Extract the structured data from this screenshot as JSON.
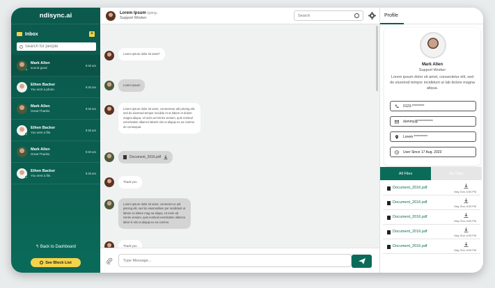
{
  "sidebar": {
    "brand": "ndisync.ai",
    "inbox_label": "Inbox",
    "add_label": "+",
    "search_placeholder": "Search for people",
    "contacts": [
      {
        "name": "Mark Allen",
        "preview": "sound good",
        "time": "9:40 am"
      },
      {
        "name": "Ethen Backer",
        "preview": "You sent a photo.",
        "time": "9:40 am"
      },
      {
        "name": "Mark Allen",
        "preview": "Great Thanks.",
        "time": "9:40 am"
      },
      {
        "name": "Ethen Backer",
        "preview": "You sent a file.",
        "time": "9:40 am"
      },
      {
        "name": "Mark Allen",
        "preview": "Great Thanks.",
        "time": "9:40 am"
      },
      {
        "name": "Ethen Backer",
        "preview": "You sent a file.",
        "time": "9:40 am"
      }
    ],
    "back_label": "Back to Dashboard",
    "block_label": "See Block List"
  },
  "chat": {
    "header_name": "Lorem Ipsum",
    "header_status": "typing..",
    "header_role": "Support Worker",
    "search_placeholder": "Search",
    "messages": [
      {
        "text": "Lorem ipsum dolor sit amet?"
      },
      {
        "text": "Lorem Ipsum"
      },
      {
        "text": "Lorem ipsum dolor sit amet, consectetur adi piscing elit, sed do eiusmod tempor incididu nt ut labore et dolore magna aliqua. Ut enim ad minim veniam, quis nostrud exercitation ullamco laboris nisi ut aliquip ex ea commo do consequat."
      },
      {
        "text": "Document_2016.pdf"
      },
      {
        "text": "Thank you"
      },
      {
        "text": "Lorem ipsum dolor sit amet, consectet ur adi piscing elit, sed do eiusmodtem por incididunt ut labore et dolore mag na aliqua. Ut enim ad minim veniam, quis nostrud exercitation ullamco labor is nisi ut aliquip ex ea commo."
      },
      {
        "text": "Thank you"
      }
    ],
    "composer_placeholder": "Type Message..."
  },
  "profile": {
    "tab_label": "Profile",
    "name": "Mark Allen",
    "role": "Support Worker",
    "bio": "Lorem ipsum dolor sit amet, consectetur elit, sed do eiusmod tempor incididunt ut lab dolore magna aliqua.",
    "phone": "0123-*********",
    "email": "dummy@***********",
    "location": "Lorem **********",
    "since": "User Since 17 Aug. 2023",
    "files_tabs": [
      "All Files",
      "My Files"
    ],
    "files": [
      {
        "name": "Document_2016.pdf",
        "date": "May 21st, 6:53 PM"
      },
      {
        "name": "Document_2016.pdf",
        "date": "May 21st, 6:53 PM"
      },
      {
        "name": "Document_2016.pdf",
        "date": "May 21st, 6:53 PM"
      },
      {
        "name": "Document_2016.pdf",
        "date": "May 21st, 6:53 PM"
      },
      {
        "name": "Document_2016.pdf",
        "date": "May 21st, 6:53 PM"
      }
    ]
  },
  "colors": {
    "brand_green": "#0b5a4d",
    "accent_yellow": "#f3d34a",
    "file_link": "#0b6b59"
  }
}
